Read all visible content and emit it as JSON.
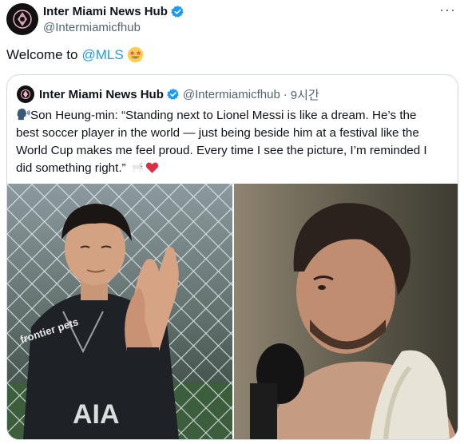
{
  "post": {
    "author_name": "Inter Miami News Hub",
    "handle": "@Intermiamicfhub",
    "more_label": "···",
    "text_prefix": "Welcome to",
    "mention": "@MLS",
    "emoji": "star-struck"
  },
  "quote": {
    "author_name": "Inter Miami News Hub",
    "handle": "@Intermiamicfhub",
    "separator": "·",
    "time": "9시간",
    "line1": "Son Heung-min: “Standing next to Lionel Messi is like a dream. He’s the",
    "line2": "best soccer player in the world — just being beside him at a festival like the",
    "line3": "World Cup makes me feel proud. Every time I see the picture, I’m reminded I",
    "line4": "did something right.”",
    "emojis": [
      "speaking-head",
      "goat",
      "red-heart"
    ]
  },
  "media": {
    "left_shirt_text": "AIA",
    "left_sponsor_text": "frontier pets"
  },
  "colors": {
    "accent": "#1d9bf0",
    "text": "#0f1419",
    "secondary": "#536471",
    "border": "#cfd9de"
  }
}
